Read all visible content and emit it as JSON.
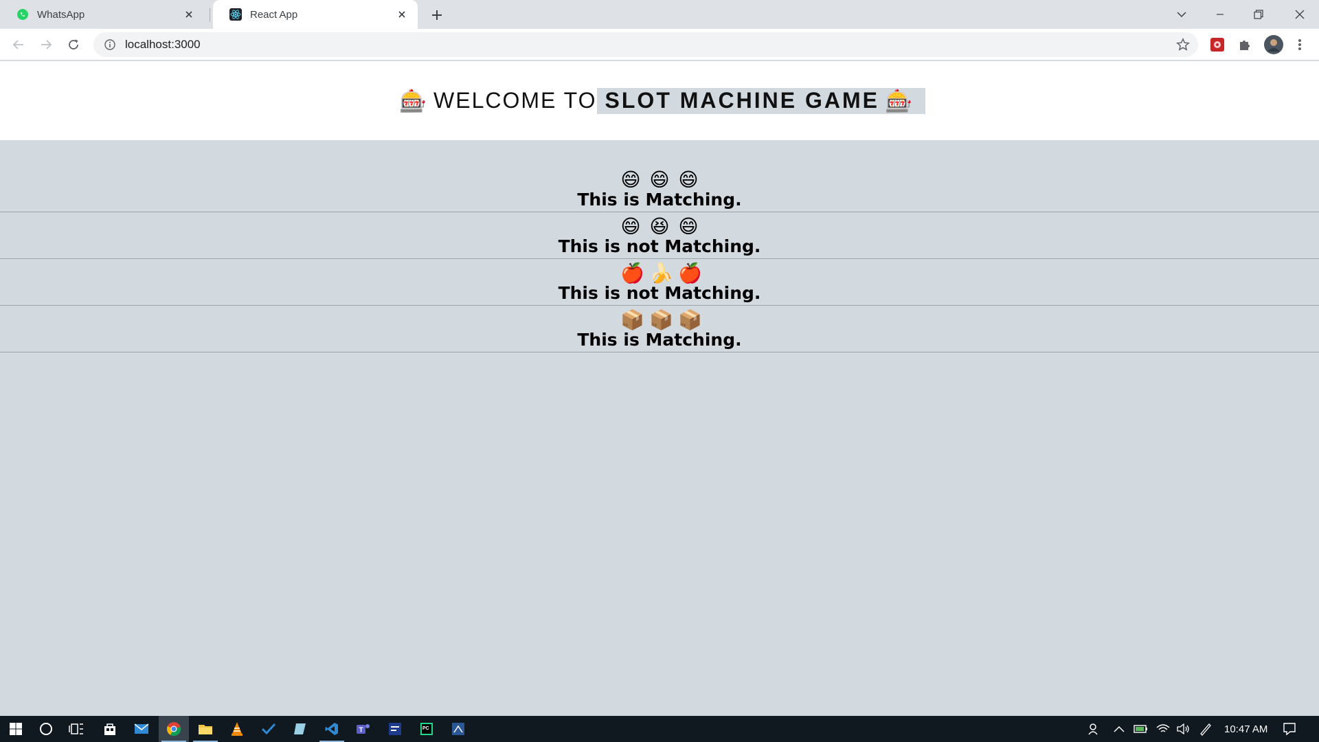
{
  "browser": {
    "tabs": [
      {
        "title": "WhatsApp",
        "favicon": "whatsapp-icon",
        "active": false
      },
      {
        "title": "React App",
        "favicon": "react-icon",
        "active": true
      }
    ],
    "address": "localhost:3000",
    "new_tab_glyph": "+",
    "colors": {
      "tabstrip": "#dee1e6",
      "toolbar": "#ffffff",
      "omnibox": "#f1f3f4"
    }
  },
  "page": {
    "header": {
      "icon_left": "🎰",
      "welcome": "WELCOME TO",
      "title": "SLOT MACHINE GAME",
      "icon_right": "🎰"
    },
    "rows": [
      {
        "emojis": [
          "😄",
          "😄",
          "😄"
        ],
        "result": "This is Matching."
      },
      {
        "emojis": [
          "😄",
          "😆",
          "😄"
        ],
        "result": "This is not Matching."
      },
      {
        "emojis": [
          "🍎",
          "🍌",
          "🍎"
        ],
        "result": "This is not Matching."
      },
      {
        "emojis": [
          "📦",
          "📦",
          "📦"
        ],
        "result": "This is Matching."
      }
    ],
    "colors": {
      "background": "#d3dadf",
      "header": "#ffffff",
      "divider": "#9aa3a9"
    }
  },
  "taskbar": {
    "clock": "10:47 AM",
    "apps": [
      "start-icon",
      "search-icon",
      "task-view-icon",
      "store-icon",
      "mail-icon",
      "chrome-icon",
      "file-explorer-icon",
      "vlc-icon",
      "todo-icon",
      "notes-icon",
      "vscode-icon",
      "teams-icon",
      "dev-icon",
      "pycharm-icon",
      "app-icon"
    ]
  }
}
